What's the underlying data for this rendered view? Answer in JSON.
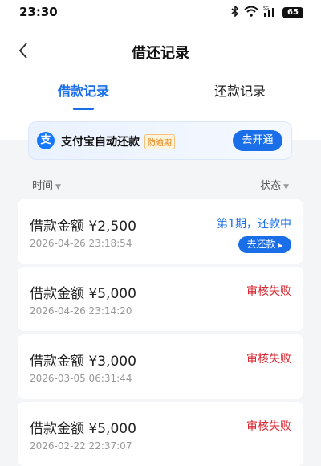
{
  "status_bar": {
    "time": "23:30",
    "battery": "65",
    "signal_label": "5G"
  },
  "header": {
    "title": "借还记录",
    "tabs": [
      {
        "label": "借款记录",
        "active": true
      },
      {
        "label": "还款记录",
        "active": false
      }
    ]
  },
  "promo": {
    "icon_char": "支",
    "title": "支付宝自动还款",
    "badge": "防逾期",
    "button_label": "去开通"
  },
  "filters": {
    "left_label": "时间",
    "right_label": "状态"
  },
  "records": [
    {
      "amount": "借款金额 ¥2,500",
      "date": "2026-04-26 23:18:54",
      "status": "第1期，还款中",
      "status_color": "#1a6ee8",
      "button_label": "去还款"
    },
    {
      "amount": "借款金额 ¥5,000",
      "date": "2026-04-26 23:14:20",
      "status": "审核失败",
      "status_color": "#d9252f"
    },
    {
      "amount": "借款金额 ¥3,000",
      "date": "2026-03-05 06:31:44",
      "status": "审核失败",
      "status_color": "#d9252f"
    },
    {
      "amount": "借款金额 ¥5,000",
      "date": "2026-02-22 22:37:07",
      "status": "审核失败",
      "status_color": "#d9252f"
    }
  ],
  "icons": {
    "back": "chevron-left-icon",
    "bluetooth": "bluetooth-icon",
    "wifi": "wifi-icon",
    "signal": "cellular-signal-icon",
    "battery": "battery-icon",
    "alipay": "alipay-logo-icon",
    "caret": "caret-down-icon",
    "play": "triangle-right-icon"
  },
  "colors": {
    "accent": "#1a6ee8",
    "fail": "#d9252f",
    "background": "#f4f5f7"
  }
}
